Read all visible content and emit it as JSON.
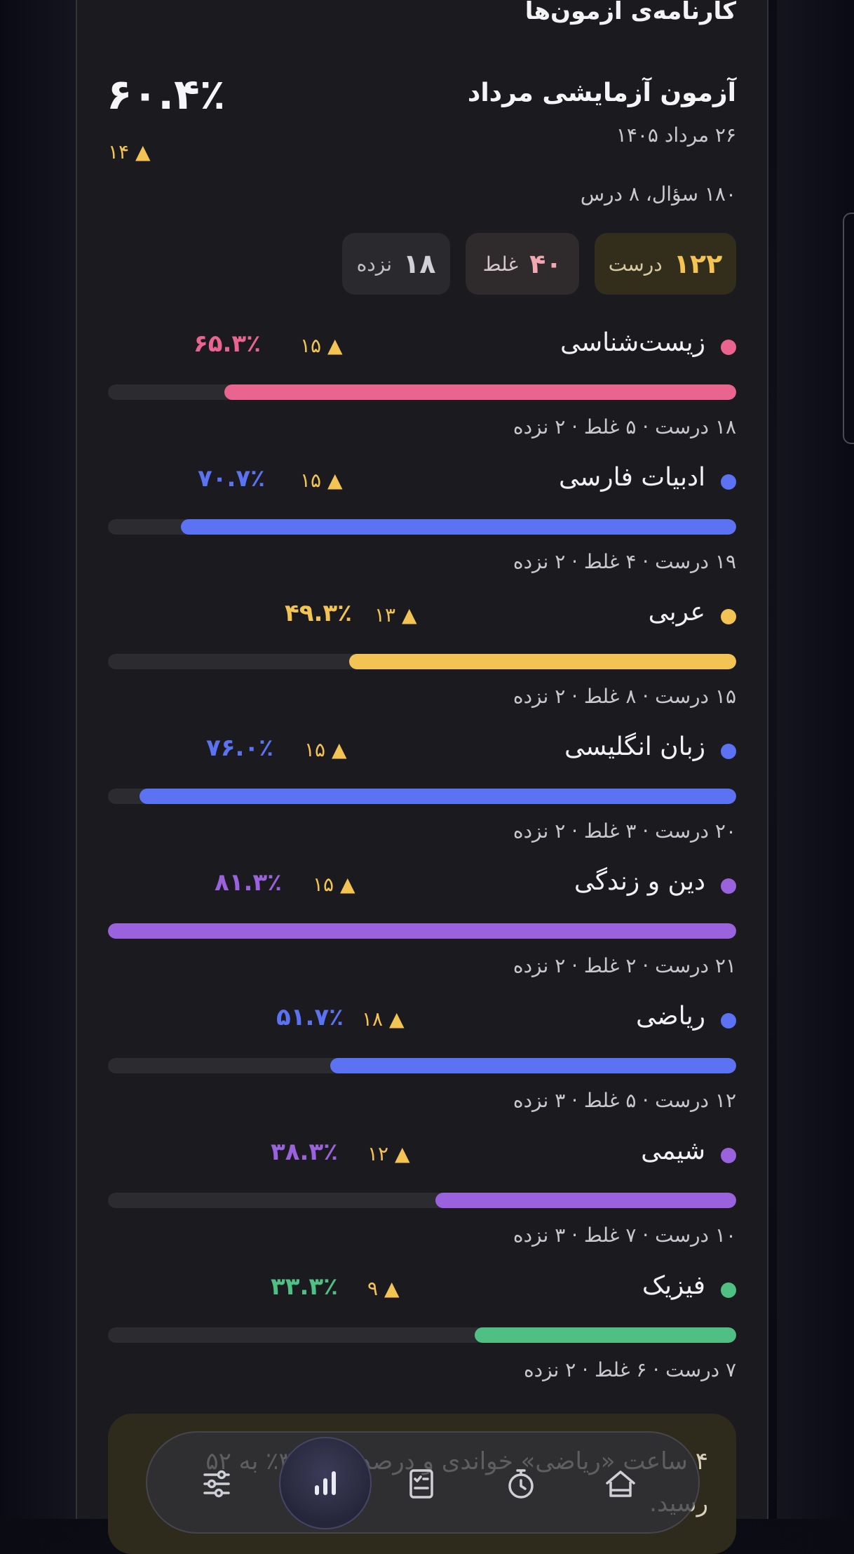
{
  "page_title": "کارنامه‌ی آزمون‌ها",
  "exam": {
    "title": "آزمون آزمایشی مرداد",
    "date": "۲۶ مرداد ۱۴۰۵",
    "meta": "۱۸۰ سؤال، ۸ درس",
    "percent": "۶۰.۴٪",
    "rank": "▲ ۱۴"
  },
  "totals": {
    "correct": {
      "num": "۱۲۲",
      "label": "درست"
    },
    "wrong": {
      "num": "۴۰",
      "label": "غلط"
    },
    "blank": {
      "num": "۱۸",
      "label": "نزده"
    }
  },
  "subjects": [
    {
      "name": "زیست‌شناسی",
      "rank": "▲ ۱۵",
      "percent": "۶۵.۳٪",
      "fill": 0.815,
      "color": "#e9648f",
      "stats": "۱۸ درست · ۵ غلط · ۲ نزده"
    },
    {
      "name": "ادبیات فارسی",
      "rank": "▲ ۱۵",
      "percent": "۷۰.۷٪",
      "fill": 0.884,
      "color": "#5b72f2",
      "stats": "۱۹ درست · ۴ غلط · ۲ نزده"
    },
    {
      "name": "عربی",
      "rank": "▲ ۱۳",
      "percent": "۴۹.۳٪",
      "fill": 0.616,
      "color": "#f3c453",
      "stats": "۱۵ درست · ۸ غلط · ۲ نزده"
    },
    {
      "name": "زبان انگلیسی",
      "rank": "▲ ۱۵",
      "percent": "۷۶.۰٪",
      "fill": 0.95,
      "color": "#5b72f2",
      "stats": "۲۰ درست · ۳ غلط · ۲ نزده"
    },
    {
      "name": "دین و زندگی",
      "rank": "▲ ۱۵",
      "percent": "۸۱.۳٪",
      "fill": 1.0,
      "color": "#9a62dc",
      "stats": "۲۱ درست · ۲ غلط · ۲ نزده"
    },
    {
      "name": "ریاضی",
      "rank": "▲ ۱۸",
      "percent": "۵۱.۷٪",
      "fill": 0.646,
      "color": "#5b72f2",
      "stats": "۱۲ درست · ۵ غلط · ۳ نزده"
    },
    {
      "name": "شیمی",
      "rank": "▲ ۱۲",
      "percent": "۳۸.۳٪",
      "fill": 0.479,
      "color": "#9a62dc",
      "stats": "۱۰ درست · ۷ غلط · ۳ نزده"
    },
    {
      "name": "فیزیک",
      "rank": "▲ ۹",
      "percent": "۳۳.۳٪",
      "fill": 0.416,
      "color": "#4fbf84",
      "stats": "۷ درست · ۶ غلط · ۲ نزده"
    }
  ],
  "insight": {
    "text": "۴ ساعت «ریاضی» خواندی و درصدت از ۳۷٪ به ۵۲ رسید."
  },
  "nav": [
    "home-icon",
    "timer-icon",
    "checklist-icon",
    "chart-icon",
    "settings-sliders-icon"
  ],
  "colors": {
    "accent_yellow": "#f3c453",
    "card_bg": "#1b1b1f"
  }
}
